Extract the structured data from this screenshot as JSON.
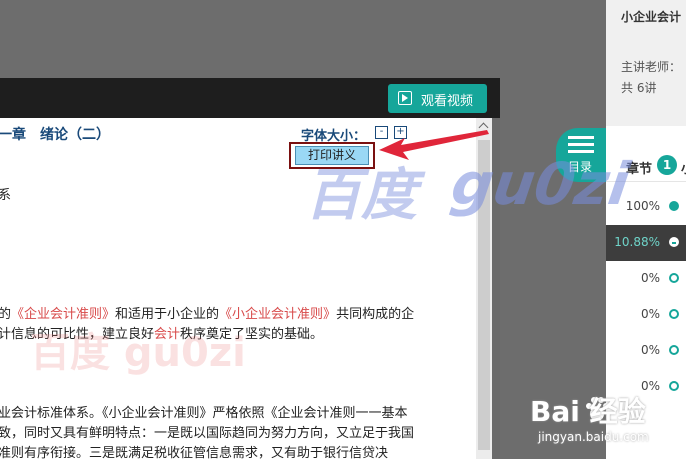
{
  "player": {
    "watch_video_label": "观看视频"
  },
  "document": {
    "chapter_title": "一章　绪论（二）",
    "font_size_label": "字体大小：",
    "font_minus": "-",
    "font_plus": "+",
    "print_label": "打印讲义",
    "line1": "系",
    "line2a": "的",
    "line2b": "《企业会计准则》",
    "line2c": "和适用于小企业的",
    "line2d": "《小企业会计准则》",
    "line2e": "共同构成的企",
    "line3a": "计信息的可比性，建立良好",
    "line3b": "会计",
    "line3c": "秩序奠定了坚实的基础。",
    "line4": "业会计标准体系。《小企业会计准则》严格依照《企业会计准则一一基本",
    "line5": "致，同时又具有鲜明特点：一是既以国际趋同为努力方向，又立足于我国",
    "line6": "准则有序衔接。三是既满足税收征管信息需求，又有助于银行信贷决"
  },
  "panel": {
    "course_title": "小企业会计",
    "teacher_label": "主讲老师：",
    "lesson_count": "共 6讲",
    "tab_chapter": "章节",
    "tab_badge": "1",
    "tab_cut": "小",
    "menu_label": "目录",
    "progress": [
      {
        "pct": "100%"
      },
      {
        "pct": "10.88%"
      },
      {
        "pct": "0%"
      },
      {
        "pct": "0%"
      },
      {
        "pct": "0%"
      },
      {
        "pct": "0%"
      }
    ]
  },
  "watermark": {
    "text": "gu0zi",
    "cn": "百度",
    "pink": "百度  gu0zi"
  },
  "logo": {
    "baidu": "Bai 经验",
    "url": "jingyan.baidu.com"
  },
  "colors": {
    "accent": "#16a69a",
    "print_border": "#7a1010",
    "print_fill": "#9ad8f5",
    "heading": "#1a4a7a"
  },
  "icons": [
    "play-icon",
    "menu-icon",
    "arrow-pointer-icon",
    "baidu-paw-icon"
  ]
}
